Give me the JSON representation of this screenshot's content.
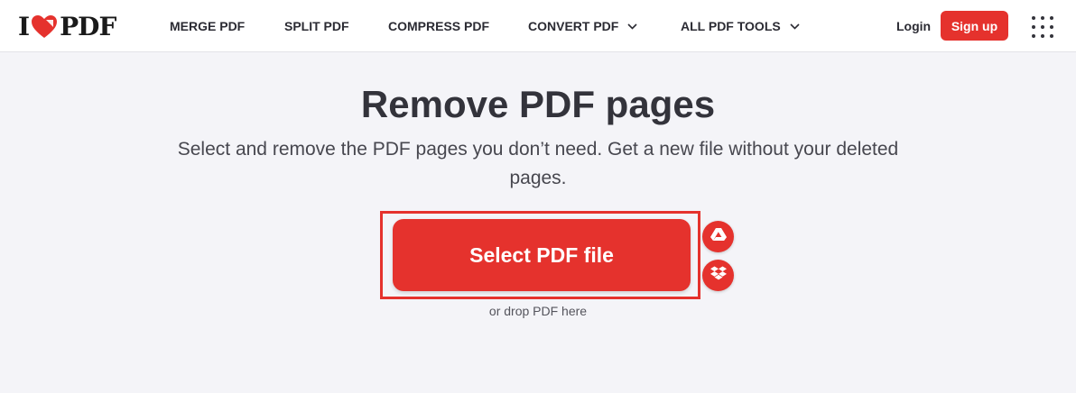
{
  "header": {
    "logo": {
      "left": "I",
      "right": "PDF"
    },
    "nav": [
      {
        "label": "MERGE PDF"
      },
      {
        "label": "SPLIT PDF"
      },
      {
        "label": "COMPRESS PDF"
      },
      {
        "label": "CONVERT PDF",
        "icon": "chevron-down-icon"
      },
      {
        "label": "ALL PDF TOOLS",
        "icon": "chevron-down-icon"
      }
    ],
    "login_label": "Login",
    "signup_label": "Sign up",
    "apps_icon": "grid-menu-icon"
  },
  "main": {
    "title": "Remove PDF pages",
    "subtitle": "Select and remove the PDF pages you don’t need. Get a new file without your deleted pages.",
    "select_button": "Select PDF file",
    "cloud_buttons": [
      {
        "icon": "google-drive-icon"
      },
      {
        "icon": "dropbox-icon"
      }
    ],
    "drop_hint": "or drop PDF here"
  },
  "colors": {
    "brand": "#e5322d",
    "background": "#f4f4f8",
    "text": "#33333b"
  }
}
